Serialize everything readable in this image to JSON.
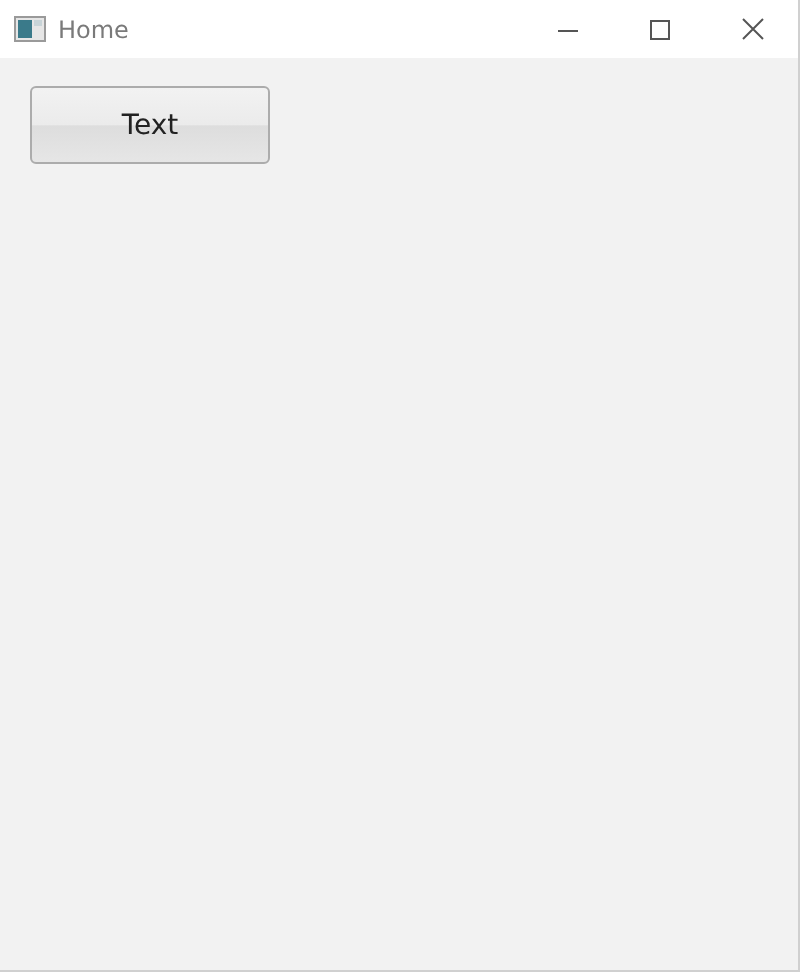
{
  "window": {
    "title": "Home"
  },
  "button": {
    "label": "Text"
  }
}
